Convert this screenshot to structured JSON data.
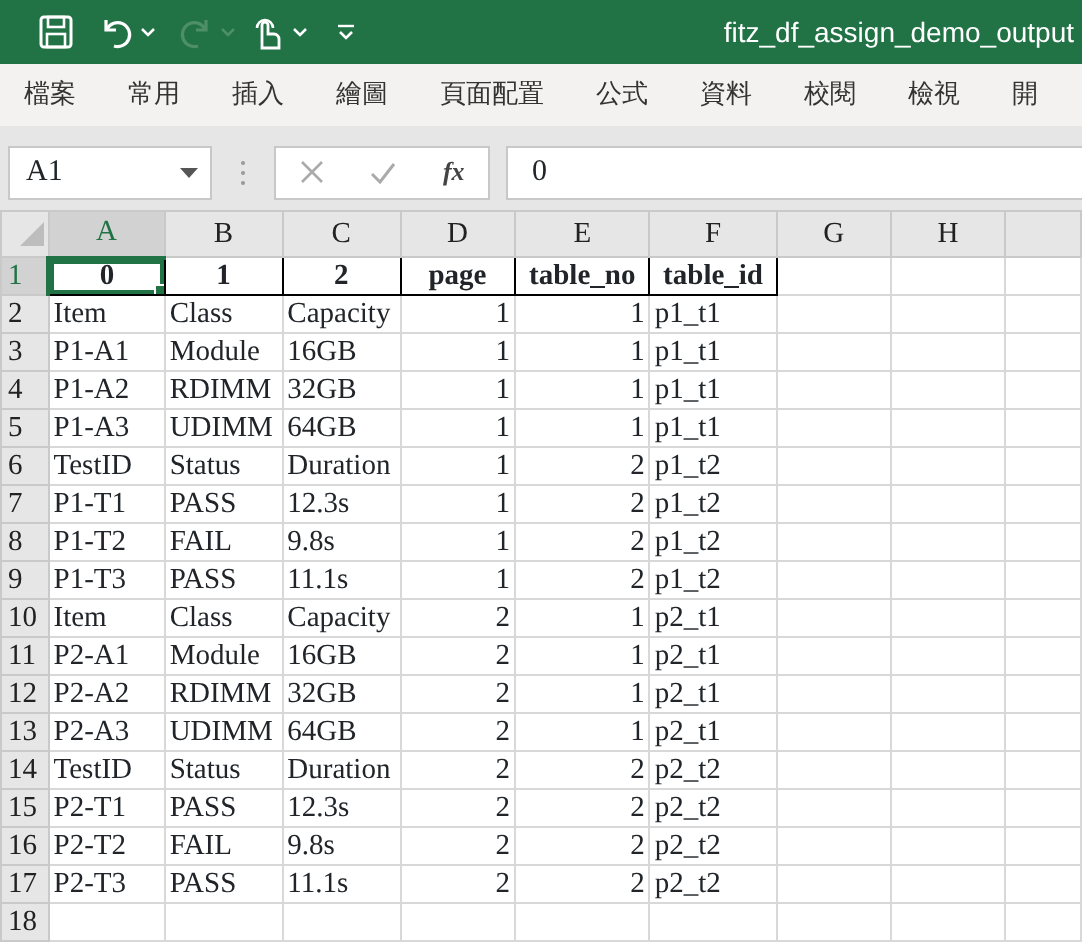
{
  "title_bar": {
    "title": "fitz_df_assign_demo_output",
    "redo_disabled": true
  },
  "ribbon_tabs": [
    {
      "label": "檔案"
    },
    {
      "label": "常用"
    },
    {
      "label": "插入"
    },
    {
      "label": "繪圖"
    },
    {
      "label": "頁面配置"
    },
    {
      "label": "公式"
    },
    {
      "label": "資料"
    },
    {
      "label": "校閱"
    },
    {
      "label": "檢視"
    },
    {
      "label": "開"
    }
  ],
  "formula_bar": {
    "name_box": "A1",
    "fx_label": "fx",
    "value": "0"
  },
  "sheet": {
    "columns": [
      {
        "letter": "A",
        "selected": true,
        "numeric": false
      },
      {
        "letter": "B",
        "selected": false,
        "numeric": false
      },
      {
        "letter": "C",
        "selected": false,
        "numeric": false
      },
      {
        "letter": "D",
        "selected": false,
        "numeric": true
      },
      {
        "letter": "E",
        "selected": false,
        "numeric": true
      },
      {
        "letter": "F",
        "selected": false,
        "numeric": false
      },
      {
        "letter": "G",
        "selected": false
      },
      {
        "letter": "H",
        "selected": false
      }
    ],
    "rows": [
      {
        "number": "1",
        "selected": true,
        "kind": "header",
        "cells": [
          "0",
          "1",
          "2",
          "page",
          "table_no",
          "table_id"
        ]
      },
      {
        "number": "2",
        "selected": false,
        "kind": "data",
        "cells": [
          "Item",
          "Class",
          "Capacity",
          "1",
          "1",
          "p1_t1"
        ]
      },
      {
        "number": "3",
        "selected": false,
        "kind": "data",
        "cells": [
          "P1-A1",
          "Module",
          "16GB",
          "1",
          "1",
          "p1_t1"
        ]
      },
      {
        "number": "4",
        "selected": false,
        "kind": "data",
        "cells": [
          "P1-A2",
          "RDIMM",
          "32GB",
          "1",
          "1",
          "p1_t1"
        ]
      },
      {
        "number": "5",
        "selected": false,
        "kind": "data",
        "cells": [
          "P1-A3",
          "UDIMM",
          "64GB",
          "1",
          "1",
          "p1_t1"
        ]
      },
      {
        "number": "6",
        "selected": false,
        "kind": "data",
        "cells": [
          "TestID",
          "Status",
          "Duration",
          "1",
          "2",
          "p1_t2"
        ]
      },
      {
        "number": "7",
        "selected": false,
        "kind": "data",
        "cells": [
          "P1-T1",
          "PASS",
          "12.3s",
          "1",
          "2",
          "p1_t2"
        ]
      },
      {
        "number": "8",
        "selected": false,
        "kind": "data",
        "cells": [
          "P1-T2",
          "FAIL",
          "9.8s",
          "1",
          "2",
          "p1_t2"
        ]
      },
      {
        "number": "9",
        "selected": false,
        "kind": "data",
        "cells": [
          "P1-T3",
          "PASS",
          "11.1s",
          "1",
          "2",
          "p1_t2"
        ]
      },
      {
        "number": "10",
        "selected": false,
        "kind": "data",
        "cells": [
          "Item",
          "Class",
          "Capacity",
          "2",
          "1",
          "p2_t1"
        ]
      },
      {
        "number": "11",
        "selected": false,
        "kind": "data",
        "cells": [
          "P2-A1",
          "Module",
          "16GB",
          "2",
          "1",
          "p2_t1"
        ]
      },
      {
        "number": "12",
        "selected": false,
        "kind": "data",
        "cells": [
          "P2-A2",
          "RDIMM",
          "32GB",
          "2",
          "1",
          "p2_t1"
        ]
      },
      {
        "number": "13",
        "selected": false,
        "kind": "data",
        "cells": [
          "P2-A3",
          "UDIMM",
          "64GB",
          "2",
          "1",
          "p2_t1"
        ]
      },
      {
        "number": "14",
        "selected": false,
        "kind": "data",
        "cells": [
          "TestID",
          "Status",
          "Duration",
          "2",
          "2",
          "p2_t2"
        ]
      },
      {
        "number": "15",
        "selected": false,
        "kind": "data",
        "cells": [
          "P2-T1",
          "PASS",
          "12.3s",
          "2",
          "2",
          "p2_t2"
        ]
      },
      {
        "number": "16",
        "selected": false,
        "kind": "data",
        "cells": [
          "P2-T2",
          "FAIL",
          "9.8s",
          "2",
          "2",
          "p2_t2"
        ]
      },
      {
        "number": "17",
        "selected": false,
        "kind": "data",
        "cells": [
          "P2-T3",
          "PASS",
          "11.1s",
          "2",
          "2",
          "p2_t2"
        ]
      },
      {
        "number": "18",
        "selected": false
      }
    ]
  }
}
